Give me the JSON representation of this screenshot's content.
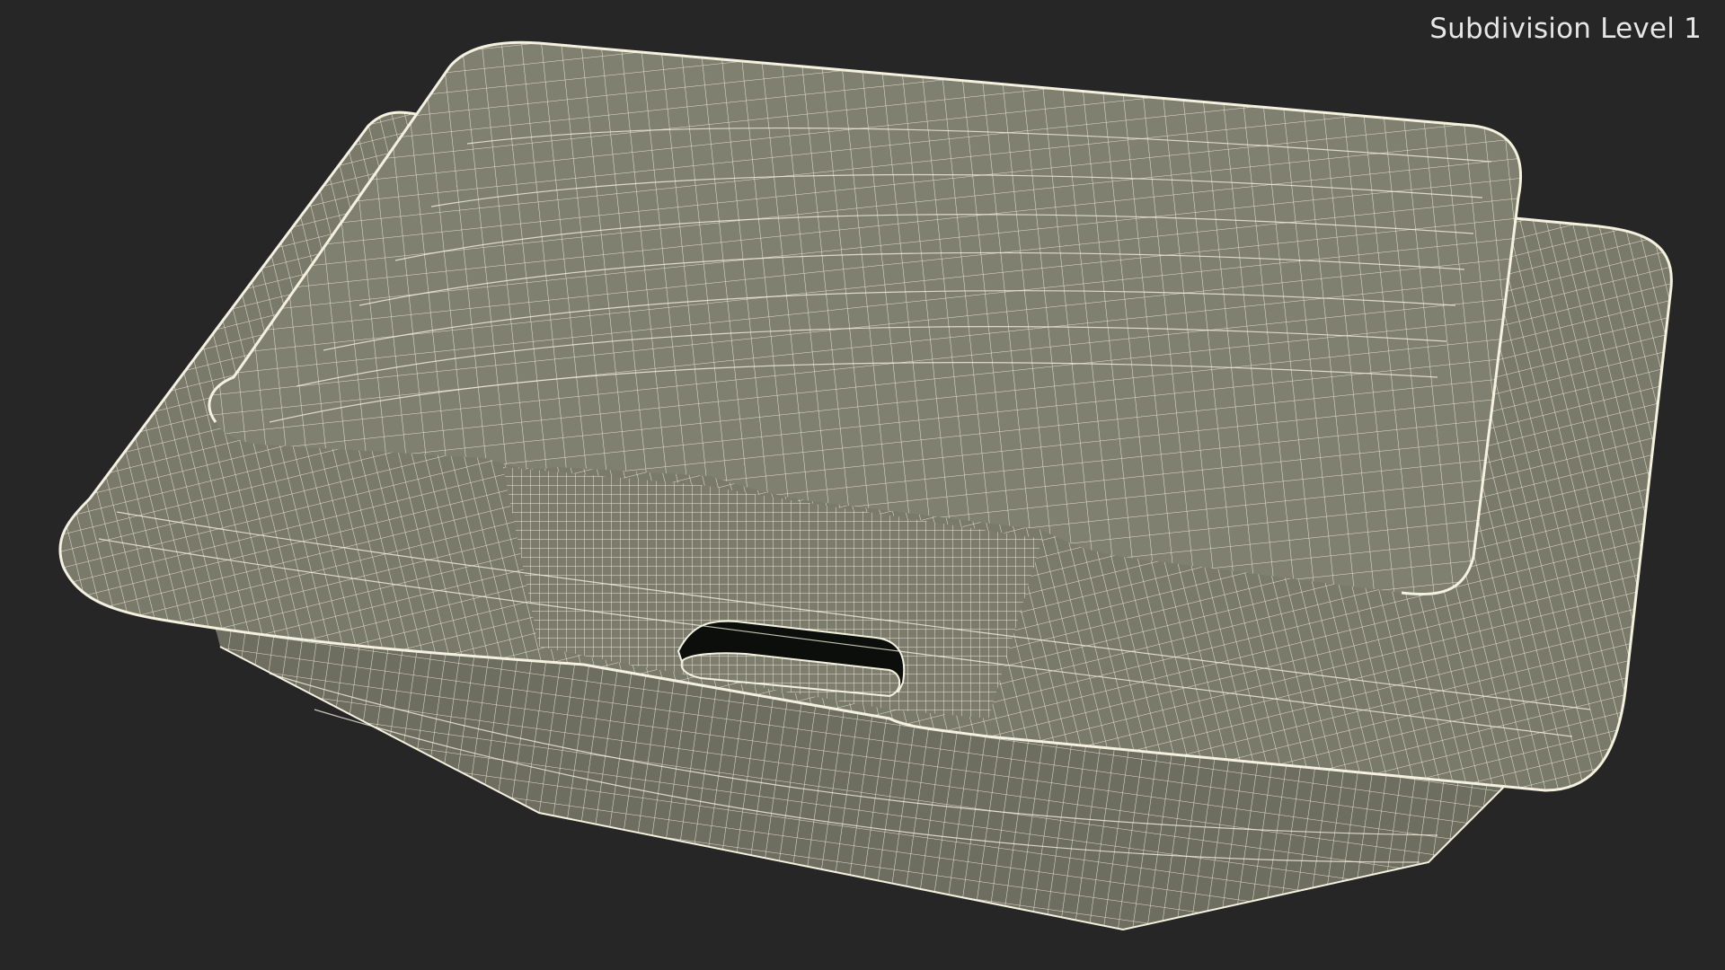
{
  "viewport": {
    "label": "Subdivision Level 1",
    "subject_icon": "wireframe-foam-container-icon",
    "colors": {
      "background": "#262626",
      "surface": "#7f7f6f",
      "surface_dark": "#6e6e60",
      "wire": "#f4f1df",
      "handle_hole": "#0c0e0c"
    }
  }
}
